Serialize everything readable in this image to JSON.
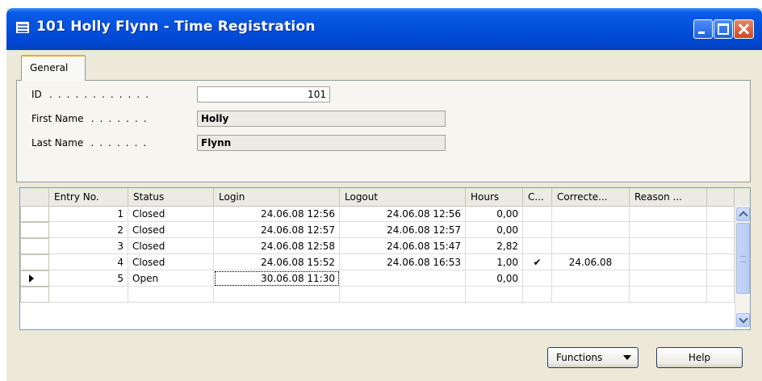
{
  "window": {
    "title": "101 Holly Flynn - Time Registration",
    "accent_color": "#0351db"
  },
  "tabs": [
    {
      "label": "General"
    }
  ],
  "form": {
    "id_label": "ID",
    "id_value": "101",
    "first_name_label": "First Name",
    "first_name_value": "Holly",
    "last_name_label": "Last Name",
    "last_name_value": "Flynn",
    "dot_leader": ". . . . . . . . . . . ."
  },
  "table": {
    "columns": [
      "Entry No.",
      "Status",
      "Login",
      "Logout",
      "Hours",
      "C...",
      "Correcte...",
      "Reason ..."
    ],
    "rows": [
      {
        "entry_no": "1",
        "status": "Closed",
        "login": "24.06.08 12:56",
        "logout": "24.06.08 12:56",
        "hours": "0,00",
        "c": "",
        "corrected": "",
        "reason": ""
      },
      {
        "entry_no": "2",
        "status": "Closed",
        "login": "24.06.08 12:57",
        "logout": "24.06.08 12:57",
        "hours": "0,00",
        "c": "",
        "corrected": "",
        "reason": ""
      },
      {
        "entry_no": "3",
        "status": "Closed",
        "login": "24.06.08 12:58",
        "logout": "24.06.08 15:47",
        "hours": "2,82",
        "c": "",
        "corrected": "",
        "reason": ""
      },
      {
        "entry_no": "4",
        "status": "Closed",
        "login": "24.06.08 15:52",
        "logout": "24.06.08 16:53",
        "hours": "1,00",
        "c": "✔",
        "corrected": "24.06.08",
        "reason": ""
      },
      {
        "entry_no": "5",
        "status": "Open",
        "login": "30.06.08 11:30",
        "logout": "",
        "hours": "0,00",
        "c": "",
        "corrected": "",
        "reason": ""
      }
    ],
    "current_row": 5
  },
  "buttons": {
    "functions_label": "Functions",
    "help_label": "Help"
  },
  "icons": {
    "window_icon": "table-form-icon",
    "minimize": "minimize-icon",
    "maximize": "maximize-icon",
    "close": "close-icon",
    "row_pointer": "row-pointer-icon",
    "scroll_up": "scroll-up-icon",
    "scroll_down": "scroll-down-icon",
    "dropdown": "chevron-down-icon"
  }
}
